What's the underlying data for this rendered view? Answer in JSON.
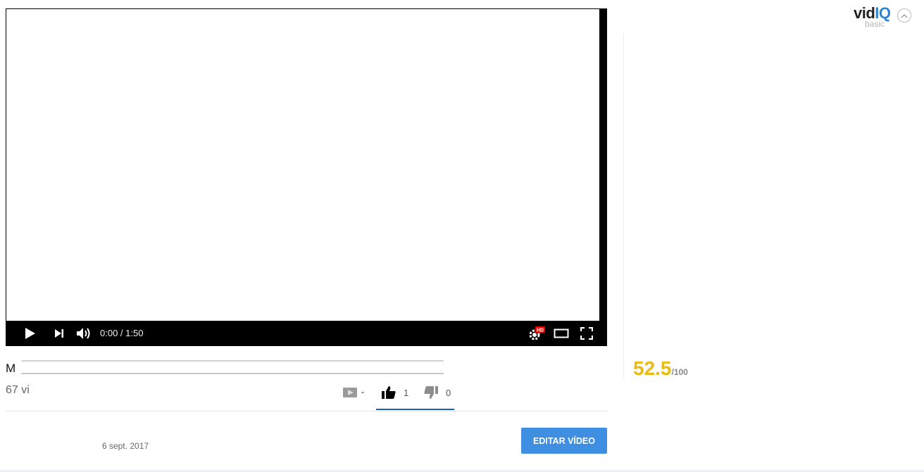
{
  "player": {
    "time_current": "0:00",
    "time_separator": " / ",
    "time_total": "1:50",
    "hd_badge": "HD",
    "icons": [
      "play-icon",
      "next-icon",
      "volume-icon",
      "settings-icon",
      "theater-mode-icon",
      "fullscreen-icon"
    ]
  },
  "video": {
    "title_visible": "M",
    "views_visible": "67 vi",
    "likes": "1",
    "dislikes": "0",
    "date": "6 sept. 2017",
    "edit_button": "EDITAR VÍDEO"
  },
  "vidiq": {
    "brand_vid": "vid",
    "brand_iq": "IQ",
    "plan": "basic",
    "score": "52.5",
    "score_max": "/100",
    "score_color": "#e9bb15",
    "brand_color": "#2b84d6"
  },
  "colors": {
    "accent_button": "#3e8ee2",
    "like_underline": "#1c62b9"
  }
}
